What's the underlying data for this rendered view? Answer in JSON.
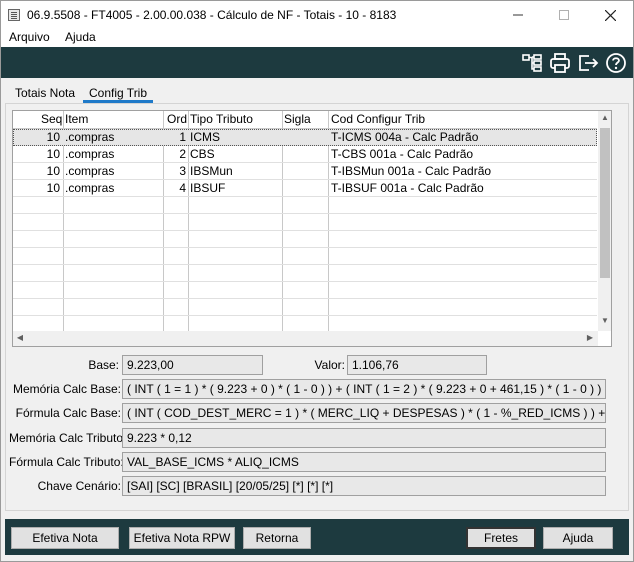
{
  "window": {
    "title": "06.9.5508 - FT4005 - 2.00.00.038 - Cálculo de NF - Totais - 10 - 8183"
  },
  "menu": {
    "items": [
      {
        "label": "Arquivo"
      },
      {
        "label": "Ajuda"
      }
    ]
  },
  "toolbar": {
    "icons": [
      "tree-structure-icon",
      "printer-icon",
      "exit-icon",
      "help-icon"
    ]
  },
  "tabs": [
    {
      "label": "Totais Nota"
    },
    {
      "label": "Config Trib"
    }
  ],
  "grid": {
    "columns": [
      "Seq",
      "Item",
      "Ord",
      "Tipo Tributo",
      "Sigla",
      "Cod Configur Trib"
    ],
    "rows": [
      {
        "seq": "10",
        "item": ".compras",
        "ord": "1",
        "tipo": "ICMS",
        "sigla": "",
        "cod": "T-ICMS 004a - Calc Padrão"
      },
      {
        "seq": "10",
        "item": ".compras",
        "ord": "2",
        "tipo": "CBS",
        "sigla": "",
        "cod": "T-CBS 001a - Calc Padrão"
      },
      {
        "seq": "10",
        "item": ".compras",
        "ord": "3",
        "tipo": "IBSMun",
        "sigla": "",
        "cod": "T-IBSMun 001a - Calc Padrão"
      },
      {
        "seq": "10",
        "item": ".compras",
        "ord": "4",
        "tipo": "IBSUF",
        "sigla": "",
        "cod": "T-IBSUF 001a - Calc Padrão"
      }
    ]
  },
  "fields": {
    "base_label": "Base:",
    "base_value": "9.223,00",
    "valor_label": "Valor:",
    "valor_value": "1.106,76",
    "memoria_base_label": "Memória Calc Base:",
    "memoria_base_value": "( INT ( 1 = 1 ) * ( 9.223 + 0 ) * ( 1 - 0 ) ) + ( INT ( 1 = 2 ) * ( 9.223 + 0 + 461,15 ) * ( 1 - 0 ) )",
    "formula_base_label": "Fórmula Calc Base:",
    "formula_base_value": "( INT ( COD_DEST_MERC = 1 ) * ( MERC_LIQ + DESPESAS ) * ( 1 - %_RED_ICMS ) ) + ( INT ( COD_",
    "memoria_trib_label": "Memória Calc Tributo:",
    "memoria_trib_value": "9.223 * 0,12",
    "formula_trib_label": "Fórmula Calc Tributo:",
    "formula_trib_value": "VAL_BASE_ICMS * ALIQ_ICMS",
    "chave_label": "Chave Cenário:",
    "chave_value": "[SAI] [SC] [BRASIL] [20/05/25] [*] [*] [*]"
  },
  "footer": {
    "efetiva_nota": "Efetiva Nota",
    "efetiva_nota_rpw": "Efetiva Nota RPW",
    "retorna": "Retorna",
    "fretes": "Fretes",
    "ajuda": "Ajuda"
  }
}
